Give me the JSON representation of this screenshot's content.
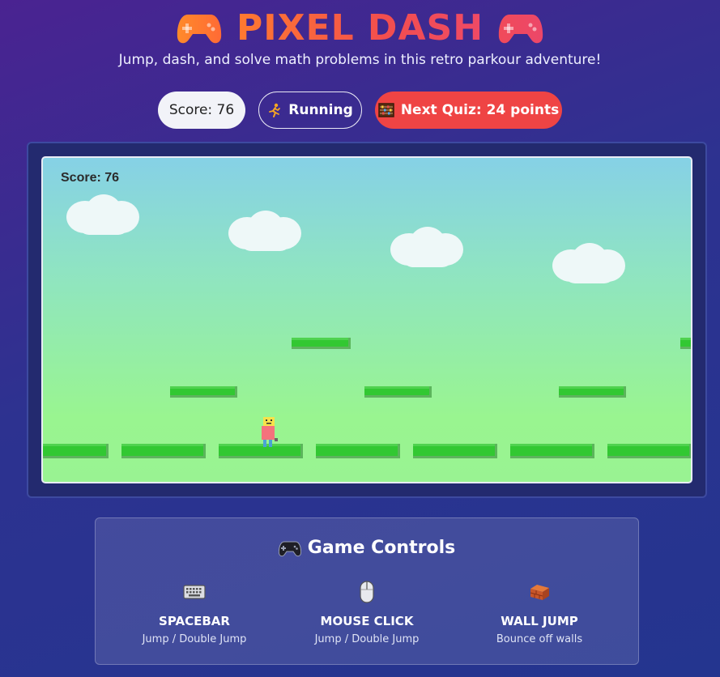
{
  "header": {
    "title": "PIXEL DASH",
    "subtitle": "Jump, dash, and solve math problems in this retro parkour adventure!"
  },
  "stats": {
    "score_label": "Score: 76",
    "status_label": "Running",
    "quiz_label": "Next Quiz: 24 points"
  },
  "game": {
    "hud_score": "Score: 76"
  },
  "controls": {
    "title": "Game Controls",
    "items": [
      {
        "icon": "keyboard-icon",
        "key": "SPACEBAR",
        "desc": "Jump / Double Jump"
      },
      {
        "icon": "mouse-icon",
        "key": "MOUSE CLICK",
        "desc": "Jump / Double Jump"
      },
      {
        "icon": "brick-icon",
        "key": "WALL JUMP",
        "desc": "Bounce off walls"
      }
    ]
  },
  "colors": {
    "accent_orange": "#ff7a2f",
    "accent_red": "#ef4444",
    "platform_green": "#32c832",
    "sky_top": "#86d1e6",
    "sky_bottom": "#99f590"
  }
}
